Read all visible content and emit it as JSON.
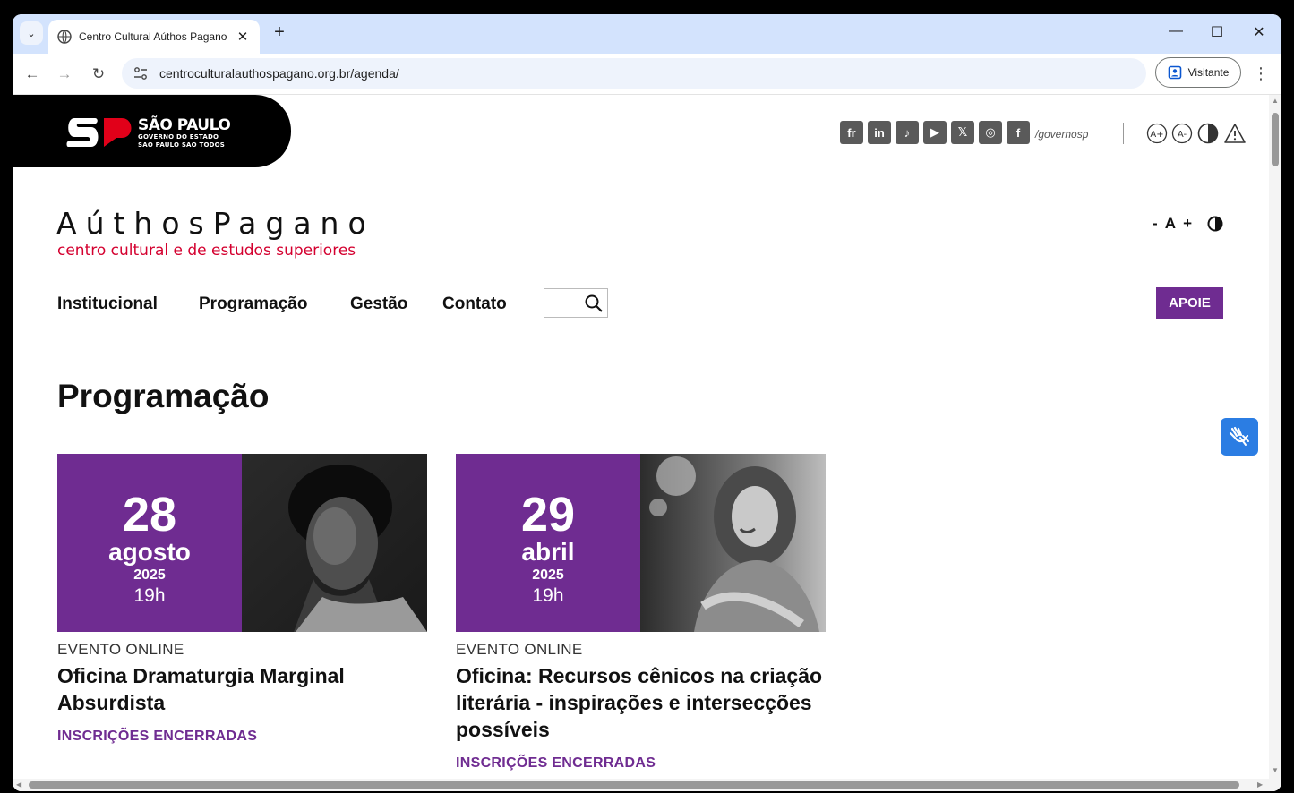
{
  "browser": {
    "tab_title": "Centro Cultural Aúthos Pagano",
    "url": "centroculturalauthospagano.org.br/agenda/",
    "profile_label": "Visitante"
  },
  "gov": {
    "line1": "SÃO PAULO",
    "line2": "GOVERNO DO ESTADO",
    "line3": "SÃO PAULO SÃO TODOS",
    "social": [
      "fr",
      "in",
      "tiktok-icon",
      "youtube-icon",
      "x-icon",
      "instagram-icon",
      "facebook-icon"
    ],
    "handle": "/governosp"
  },
  "site": {
    "brand": "AúthosPagano",
    "subtitle": "centro cultural e de estudos superiores",
    "font_controls": "- A +",
    "nav": [
      "Institucional",
      "Programação",
      "Gestão",
      "Contato"
    ],
    "apoie": "APOIE",
    "page_title": "Programação"
  },
  "events": [
    {
      "day": "28",
      "month": "agosto",
      "year": "2025",
      "hour": "19h",
      "type": "EVENTO ONLINE",
      "title": "Oficina Dramaturgia Marginal Absurdista",
      "status": "INSCRIÇÕES ENCERRADAS"
    },
    {
      "day": "29",
      "month": "abril",
      "year": "2025",
      "hour": "19h",
      "type": "EVENTO ONLINE",
      "title": "Oficina: Recursos cênicos na criação literária - inspirações e intersecções possíveis",
      "status": "INSCRIÇÕES ENCERRADAS"
    }
  ],
  "colors": {
    "purple": "#6f2c91",
    "brand_red": "#d4002f",
    "vlibras_blue": "#2b7de3"
  }
}
